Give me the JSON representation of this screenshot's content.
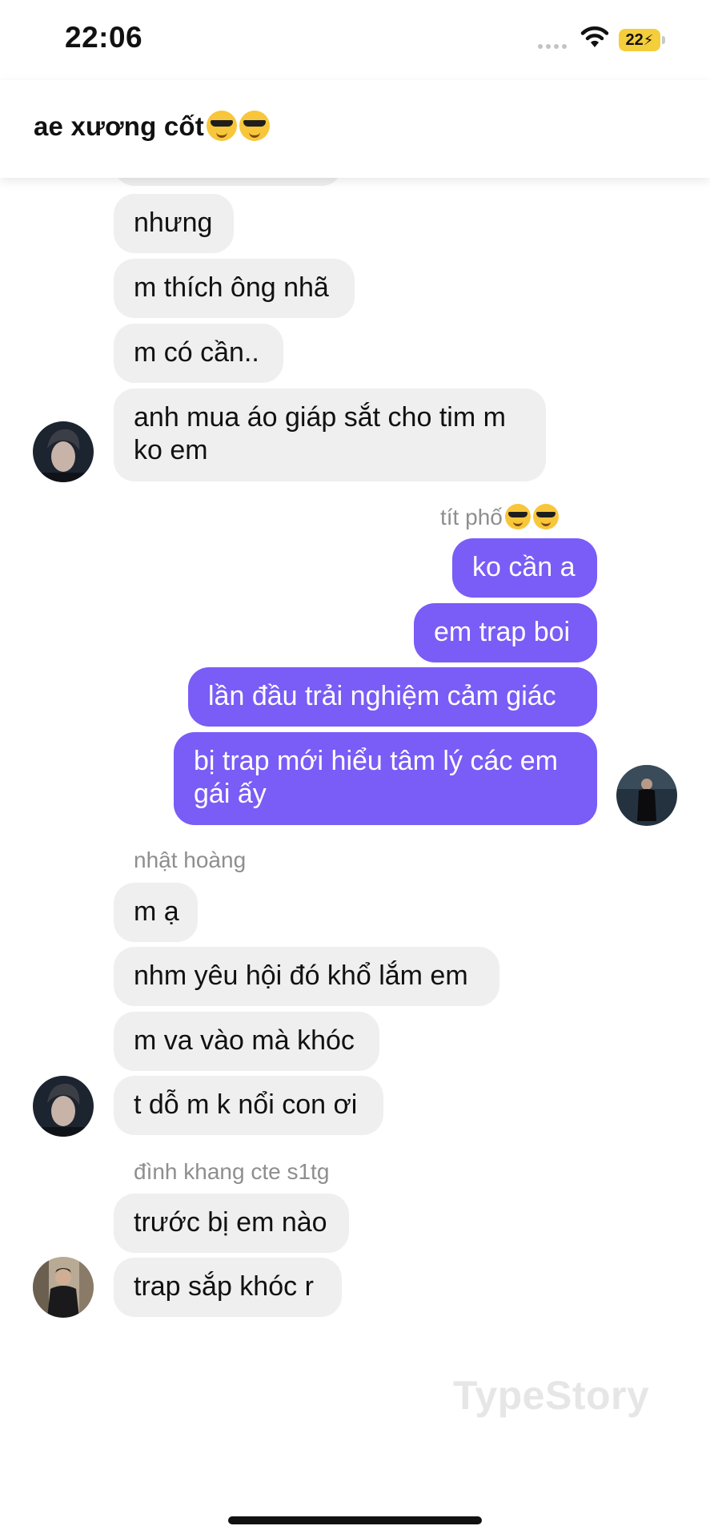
{
  "status_bar": {
    "time": "22:06",
    "battery": "22"
  },
  "header": {
    "title": "ae xương cốt"
  },
  "messages": {
    "group1": [
      "nhưng",
      "m thích ông nhã",
      "m có cần..",
      "anh mua áo giáp sắt cho tim m ko em"
    ],
    "group2_sender": "tít phố",
    "group2": [
      "ko cần a",
      "em trap boi",
      "lần đầu trải nghiệm cảm giác",
      "bị trap mới hiểu tâm lý các em gái ấy"
    ],
    "group3_sender": "nhật hoàng",
    "group3": [
      "m ạ",
      "nhm yêu hội đó khổ lắm em",
      "m va vào mà khóc",
      "t dỗ m k nổi con ơi"
    ],
    "group4_sender": "đình khang cte s1tg",
    "group4": [
      "trước bị em nào",
      "trap sắp khóc r"
    ]
  },
  "watermark": "TypeStory",
  "colors": {
    "outgoing_bubble": "#7a5cf6",
    "incoming_bubble": "#efefef",
    "battery": "#f4ce3b"
  }
}
